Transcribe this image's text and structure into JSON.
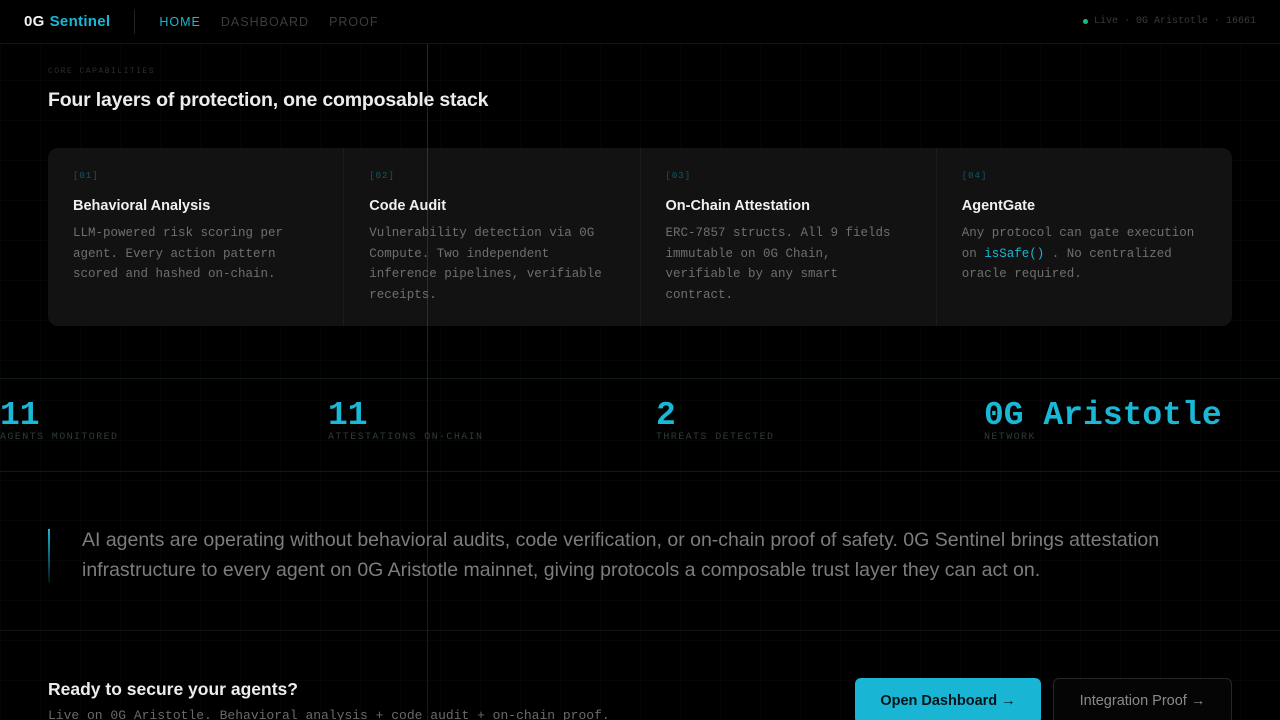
{
  "nav": {
    "brand_part1": "0G",
    "brand_part2": "Sentinel",
    "links": [
      {
        "label": "HOME",
        "active": true
      },
      {
        "label": "DASHBOARD",
        "active": false
      },
      {
        "label": "PROOF",
        "active": false
      }
    ],
    "status": "Live · 0G Aristotle · 16661"
  },
  "capabilities": {
    "kicker": "CORE CAPABILITIES",
    "title": "Four layers of protection, one composable stack",
    "cards": [
      {
        "num": "[01]",
        "title": "Behavioral Analysis",
        "desc": "LLM-powered risk scoring per agent. Every action pattern scored and hashed on-chain."
      },
      {
        "num": "[02]",
        "title": "Code Audit",
        "desc": "Vulnerability detection via 0G Compute. Two independent inference pipelines, verifiable receipts."
      },
      {
        "num": "[03]",
        "title": "On-Chain Attestation",
        "desc": "ERC-7857 structs. All 9 fields immutable on 0G Chain, verifiable by any smart contract."
      },
      {
        "num": "[04]",
        "title": "AgentGate",
        "desc_before": "Any protocol can gate execution on ",
        "desc_code": "isSafe()",
        "desc_after": " . No centralized oracle required."
      }
    ]
  },
  "stats": [
    {
      "value": "11",
      "label": "AGENTS MONITORED"
    },
    {
      "value": "11",
      "label": "ATTESTATIONS ON-CHAIN"
    },
    {
      "value": "2",
      "label": "THREATS DETECTED"
    },
    {
      "value": "0G Aristotle",
      "label": "NETWORK"
    }
  ],
  "quote": "AI agents are operating without behavioral audits, code verification, or on-chain proof of safety. 0G Sentinel brings attestation infrastructure to every agent on 0G Aristotle mainnet, giving protocols a composable trust layer they can act on.",
  "cta": {
    "title": "Ready to secure your agents?",
    "subtitle": "Live on 0G Aristotle. Behavioral analysis + code audit + on-chain proof.",
    "primary_label": "Open Dashboard →",
    "secondary_label": "Integration Proof →"
  },
  "colors": {
    "accent": "#19b8d6",
    "live": "#16c27a",
    "background": "#000000"
  }
}
